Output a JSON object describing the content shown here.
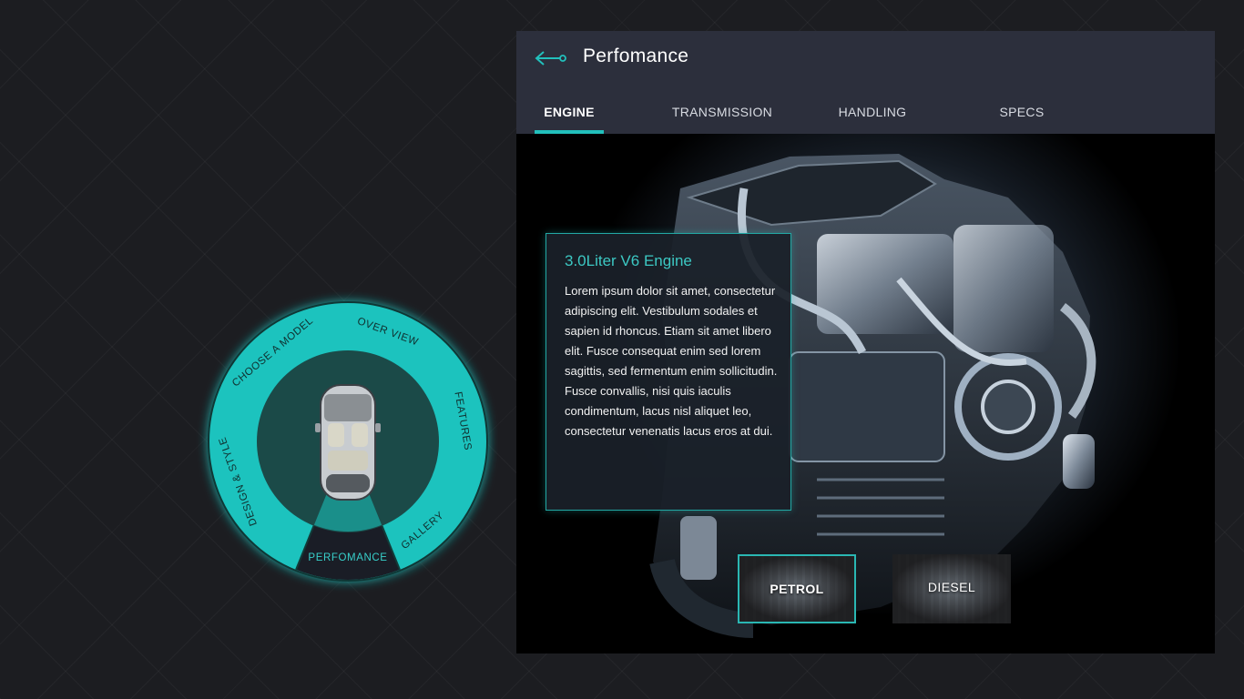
{
  "colors": {
    "accent": "#22c0bc",
    "header_bg": "#2c2f3c",
    "page_bg": "#1c1d21",
    "wheel_ring": "#1fc3be",
    "wheel_inner": "#1b4a48"
  },
  "wheel_menu": {
    "items": [
      {
        "label": "OVER VIEW",
        "active": false
      },
      {
        "label": "FEATURES",
        "active": false
      },
      {
        "label": "GALLERY",
        "active": false
      },
      {
        "label": "PERFOMANCE",
        "active": true
      },
      {
        "label": "DESIGN & STYLE",
        "active": false
      },
      {
        "label": "CHOOSE A MODEL",
        "active": false
      }
    ],
    "center_icon": "car-top-view-icon"
  },
  "header": {
    "back_icon": "back-arrow-icon",
    "title": "Perfomance"
  },
  "tabs": [
    {
      "label": "ENGINE",
      "active": true
    },
    {
      "label": "TRANSMISSION",
      "active": false
    },
    {
      "label": "HANDLING",
      "active": false
    },
    {
      "label": "SPECS",
      "active": false
    }
  ],
  "info": {
    "title": "3.0Liter V6 Engine",
    "text": "Lorem ipsum dolor sit amet, consectetur adipiscing elit. Vestibulum sodales et sapien id rhoncus. Etiam sit amet libero elit. Fusce consequat enim sed lorem sagittis, sed fermentum enim sollicitudin. Fusce convallis, nisi quis iaculis condimentum, lacus nisl aliquet leo, consectetur venenatis lacus eros at dui."
  },
  "variants": [
    {
      "label": "PETROL",
      "selected": true
    },
    {
      "label": "DIESEL",
      "selected": false
    }
  ]
}
